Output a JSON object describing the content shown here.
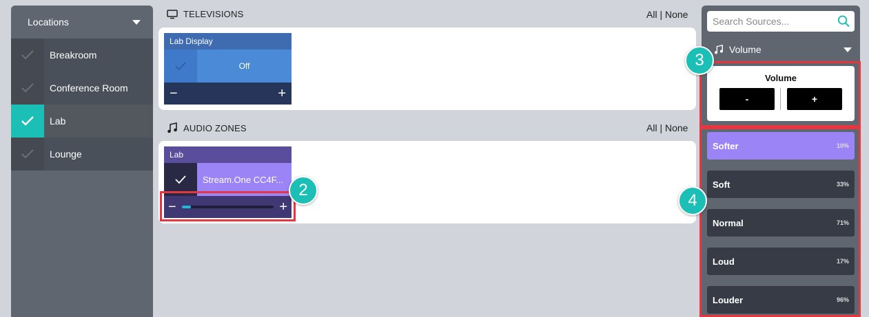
{
  "sidebar": {
    "header": "Locations",
    "items": [
      {
        "label": "Breakroom",
        "active": false
      },
      {
        "label": "Conference Room",
        "active": false
      },
      {
        "label": "Lab",
        "active": true
      },
      {
        "label": "Lounge",
        "active": false
      }
    ]
  },
  "televisions": {
    "title": "TELEVISIONS",
    "all": "All",
    "separator": "|",
    "none": "None",
    "tile": {
      "name": "Lab Display",
      "state": "Off",
      "minus": "−",
      "plus": "+"
    }
  },
  "audio_zones": {
    "title": "AUDIO ZONES",
    "all": "All",
    "separator": "|",
    "none": "None",
    "tile": {
      "name": "Lab",
      "source": "Stream.One CC4F...",
      "minus": "−",
      "plus": "+",
      "volume_fraction": 0.1
    }
  },
  "right_panel": {
    "search_placeholder": "Search Sources...",
    "selector_label": "Volume",
    "volume_card": {
      "title": "Volume",
      "minus": "-",
      "plus": "+"
    },
    "presets": [
      {
        "name": "Softer",
        "percent": "10%",
        "active": true
      },
      {
        "name": "Soft",
        "percent": "33%",
        "active": false
      },
      {
        "name": "Normal",
        "percent": "71%",
        "active": false
      },
      {
        "name": "Loud",
        "percent": "17%",
        "active": false
      },
      {
        "name": "Louder",
        "percent": "96%",
        "active": false
      }
    ]
  },
  "callouts": {
    "c2": "2",
    "c3": "3",
    "c4": "4"
  },
  "colors": {
    "accent": "#1bbfb5",
    "highlight": "#e4373f",
    "purple": "#9b84f5",
    "tv_blue": "#4a8ad6"
  },
  "icons": {
    "tv": "tv-icon",
    "music": "music-note-icon",
    "search": "search-icon",
    "check": "check-icon",
    "caret": "caret-down-icon"
  }
}
